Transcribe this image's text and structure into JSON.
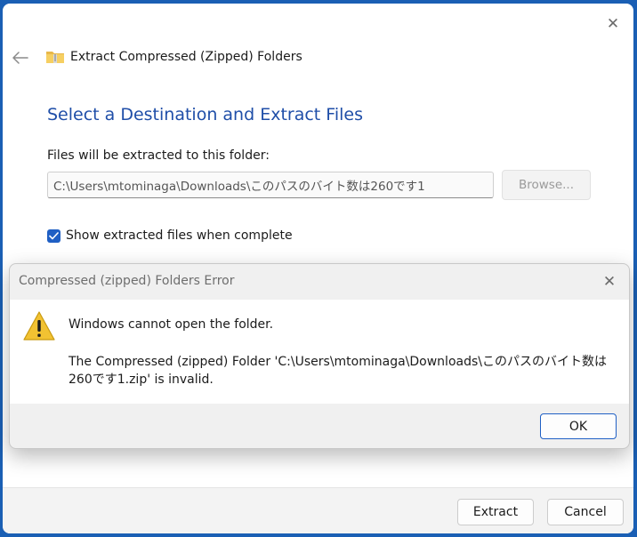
{
  "wizard": {
    "title": "Extract Compressed (Zipped) Folders",
    "heading": "Select a Destination and Extract Files",
    "path_label": "Files will be extracted to this folder:",
    "path_value": "C:\\Users\\mtominaga\\Downloads\\このパスのバイト数は260です1",
    "browse_label": "Browse...",
    "show_files_label": "Show extracted files when complete",
    "show_files_checked": true,
    "extract_label": "Extract",
    "cancel_label": "Cancel",
    "close_glyph": "✕"
  },
  "error_dialog": {
    "title": "Compressed (zipped) Folders Error",
    "message": "Windows cannot open the folder.",
    "detail": "The Compressed (zipped) Folder 'C:\\Users\\mtominaga\\Downloads\\このパスのバイト数は260です1.zip' is invalid.",
    "ok_label": "OK",
    "close_glyph": "✕"
  },
  "colors": {
    "accent": "#1f5fc4",
    "heading": "#1f4ea8",
    "warning": "#f2c232"
  },
  "icons": [
    "back-arrow-icon",
    "zip-folder-icon",
    "close-icon",
    "checkmark-icon",
    "warning-icon"
  ]
}
